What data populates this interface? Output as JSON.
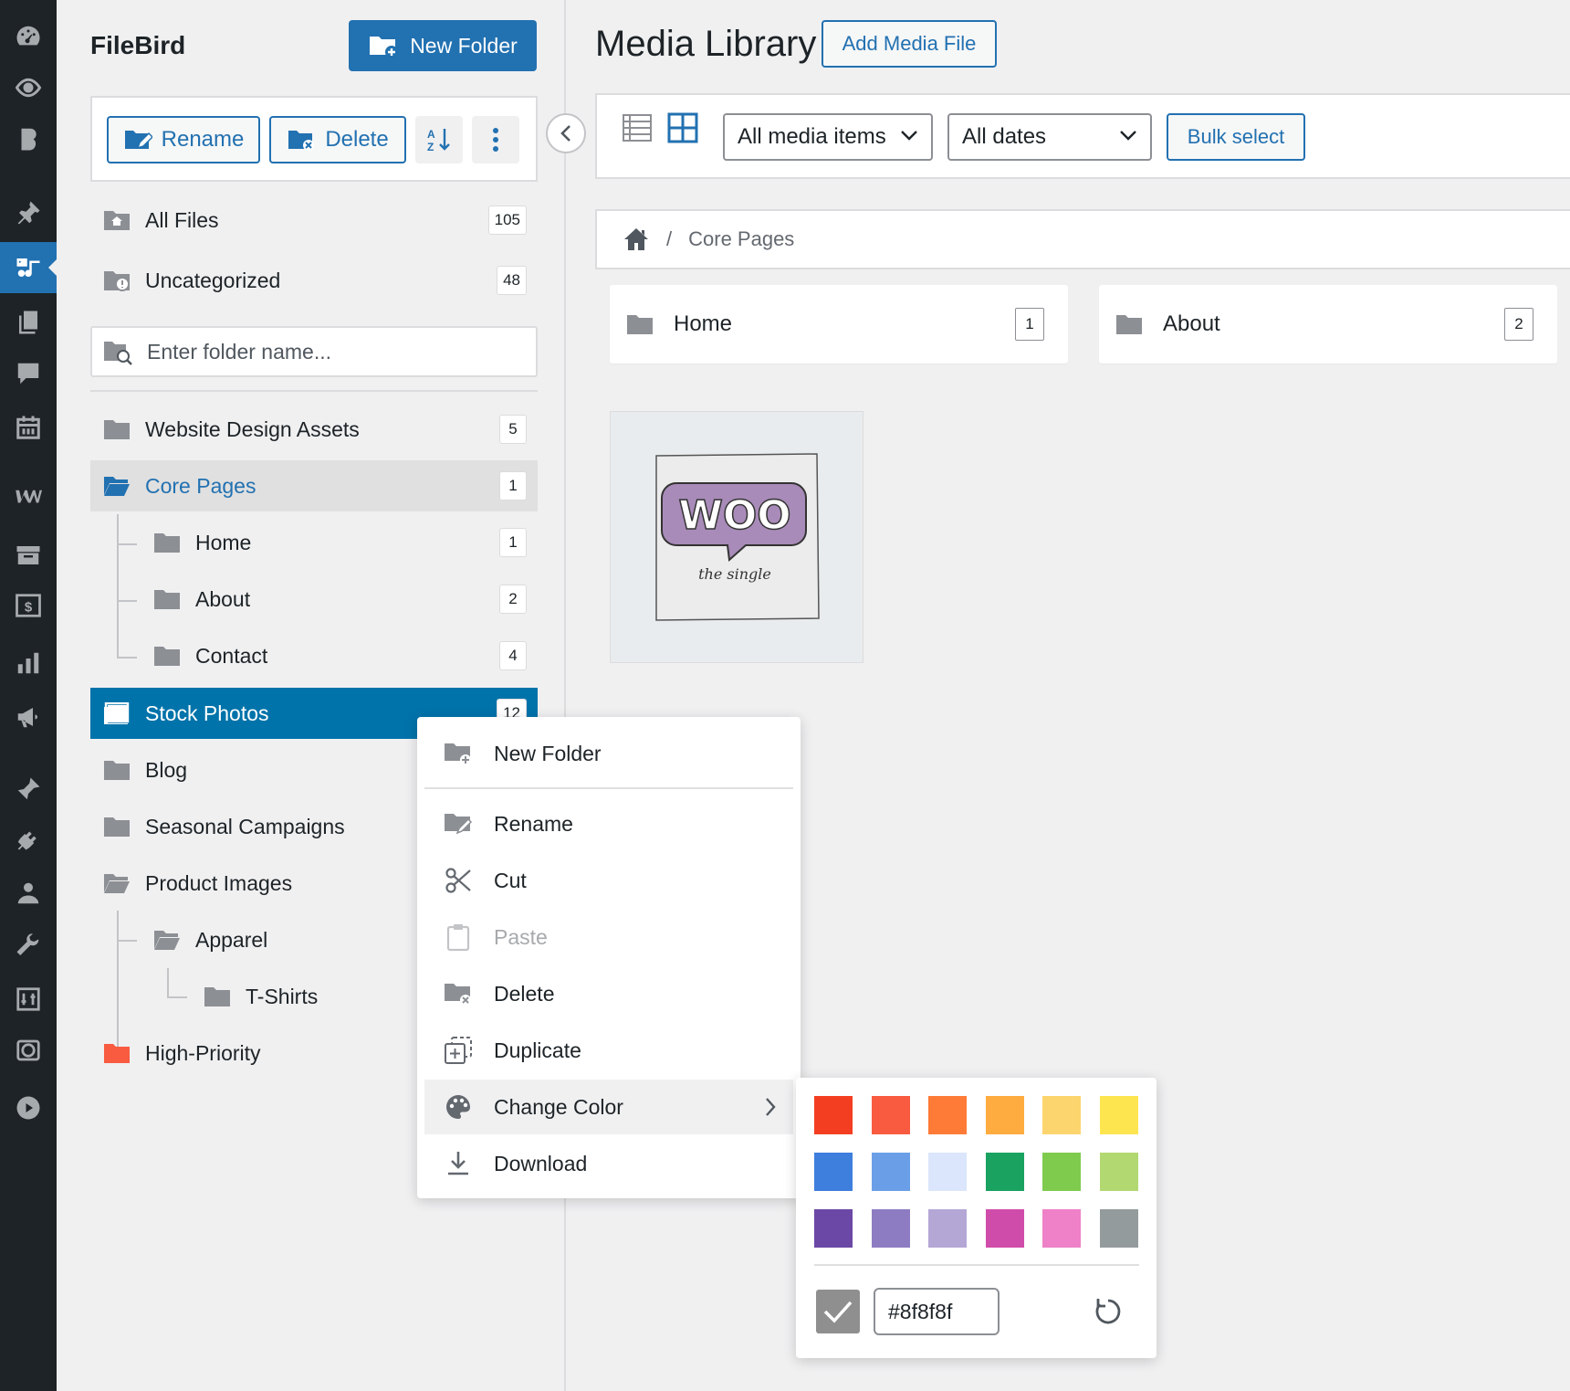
{
  "filebird": {
    "title": "FileBird",
    "new_folder_label": "New Folder",
    "rename_label": "Rename",
    "delete_label": "Delete",
    "search_placeholder": "Enter folder name...",
    "all_files": {
      "label": "All Files",
      "count": "105"
    },
    "uncategorized": {
      "label": "Uncategorized",
      "count": "48"
    },
    "folders": [
      {
        "label": "Website Design Assets",
        "count": "5"
      },
      {
        "label": "Core Pages",
        "count": "1"
      },
      {
        "label": "Home",
        "count": "1"
      },
      {
        "label": "About",
        "count": "2"
      },
      {
        "label": "Contact",
        "count": "4"
      },
      {
        "label": "Stock Photos",
        "count": "12"
      },
      {
        "label": "Blog",
        "count": ""
      },
      {
        "label": "Seasonal Campaigns",
        "count": ""
      },
      {
        "label": "Product Images",
        "count": ""
      },
      {
        "label": "Apparel",
        "count": ""
      },
      {
        "label": "T-Shirts",
        "count": ""
      },
      {
        "label": "High-Priority",
        "count": ""
      }
    ]
  },
  "main": {
    "title": "Media Library",
    "add_media_label": "Add Media File",
    "filter_type": "All media items",
    "filter_date": "All dates",
    "bulk_select_label": "Bulk select",
    "breadcrumb": {
      "separator": "/",
      "current": "Core Pages"
    },
    "folder_cards": [
      {
        "label": "Home",
        "count": "1"
      },
      {
        "label": "About",
        "count": "2"
      }
    ],
    "thumbnail": {
      "logo_text": "WOO",
      "caption": "the single"
    }
  },
  "context_menu": {
    "items": [
      {
        "label": "New Folder",
        "icon": "folder-plus-icon"
      },
      {
        "label": "Rename",
        "icon": "folder-edit-icon"
      },
      {
        "label": "Cut",
        "icon": "scissors-icon"
      },
      {
        "label": "Paste",
        "icon": "clipboard-icon",
        "disabled": true
      },
      {
        "label": "Delete",
        "icon": "folder-delete-icon"
      },
      {
        "label": "Duplicate",
        "icon": "duplicate-icon"
      },
      {
        "label": "Change Color",
        "icon": "palette-icon",
        "has_submenu": true
      },
      {
        "label": "Download",
        "icon": "download-icon"
      }
    ]
  },
  "color_picker": {
    "swatches": [
      "#f43e22",
      "#f85b40",
      "#fd7b37",
      "#feab3f",
      "#fdd56e",
      "#fde54f",
      "#3e7edc",
      "#6a9fe8",
      "#dbe5fb",
      "#1aa261",
      "#7fcb4e",
      "#b2d871",
      "#6b48a5",
      "#8e7cc3",
      "#b4a7d6",
      "#d04caa",
      "#ee81c7",
      "#949b9c"
    ],
    "value": "#8f8f8f"
  },
  "colors": {
    "accent": "#2271b1",
    "selected_row": "#0073aa",
    "admin_bar": "#1d2327",
    "high_priority_folder": "#f85b40"
  }
}
